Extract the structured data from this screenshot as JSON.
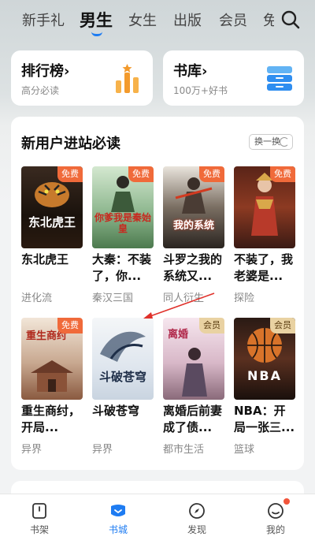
{
  "top_tabs": [
    {
      "label": "新手礼"
    },
    {
      "label": "男生"
    },
    {
      "label": "女生"
    },
    {
      "label": "出版"
    },
    {
      "label": "会员"
    },
    {
      "label": "免"
    }
  ],
  "cards": {
    "ranking": {
      "title": "排行榜",
      "chevron": "›",
      "subtitle": "高分必读"
    },
    "library": {
      "title": "书库",
      "chevron": "›",
      "subtitle": "100万+好书"
    }
  },
  "section": {
    "title": "新用户进站必读",
    "refresh_label": "换一换"
  },
  "books": [
    {
      "title": "东北虎王",
      "genre": "进化流",
      "tag": "免费",
      "cover_text": "东北虎王"
    },
    {
      "title": "大秦：不装了，你...",
      "genre": "秦汉三国",
      "tag": "免费",
      "cover_text": "你爹我是秦始皇"
    },
    {
      "title": "斗罗之我的系统又...",
      "genre": "同人衍生",
      "tag": "免费",
      "cover_text": "我的系统"
    },
    {
      "title": "不装了，我老婆是...",
      "genre": "探险",
      "tag": "免费",
      "cover_text": ""
    },
    {
      "title": "重生商纣，开局...",
      "genre": "异界",
      "tag": "免费",
      "cover_text": "重生商纣"
    },
    {
      "title": "斗破苍穹",
      "genre": "异界",
      "tag": "",
      "cover_text": "斗破苍穹"
    },
    {
      "title": "离婚后前妻成了债...",
      "genre": "都市生活",
      "tag": "会员",
      "cover_text": "离婚"
    },
    {
      "title": "NBA：开局一张三...",
      "genre": "篮球",
      "tag": "会员",
      "cover_text": "NBA"
    }
  ],
  "bottom_nav": [
    {
      "label": "书架",
      "icon": "bookshelf-icon"
    },
    {
      "label": "书城",
      "icon": "bookstore-icon"
    },
    {
      "label": "发现",
      "icon": "compass-icon"
    },
    {
      "label": "我的",
      "icon": "profile-icon"
    }
  ],
  "colors": {
    "accent": "#1e7cf2",
    "free_tag": "#f06a3a",
    "vip_tag": "#e9d2a2",
    "annotation_arrow": "#e0312b"
  }
}
